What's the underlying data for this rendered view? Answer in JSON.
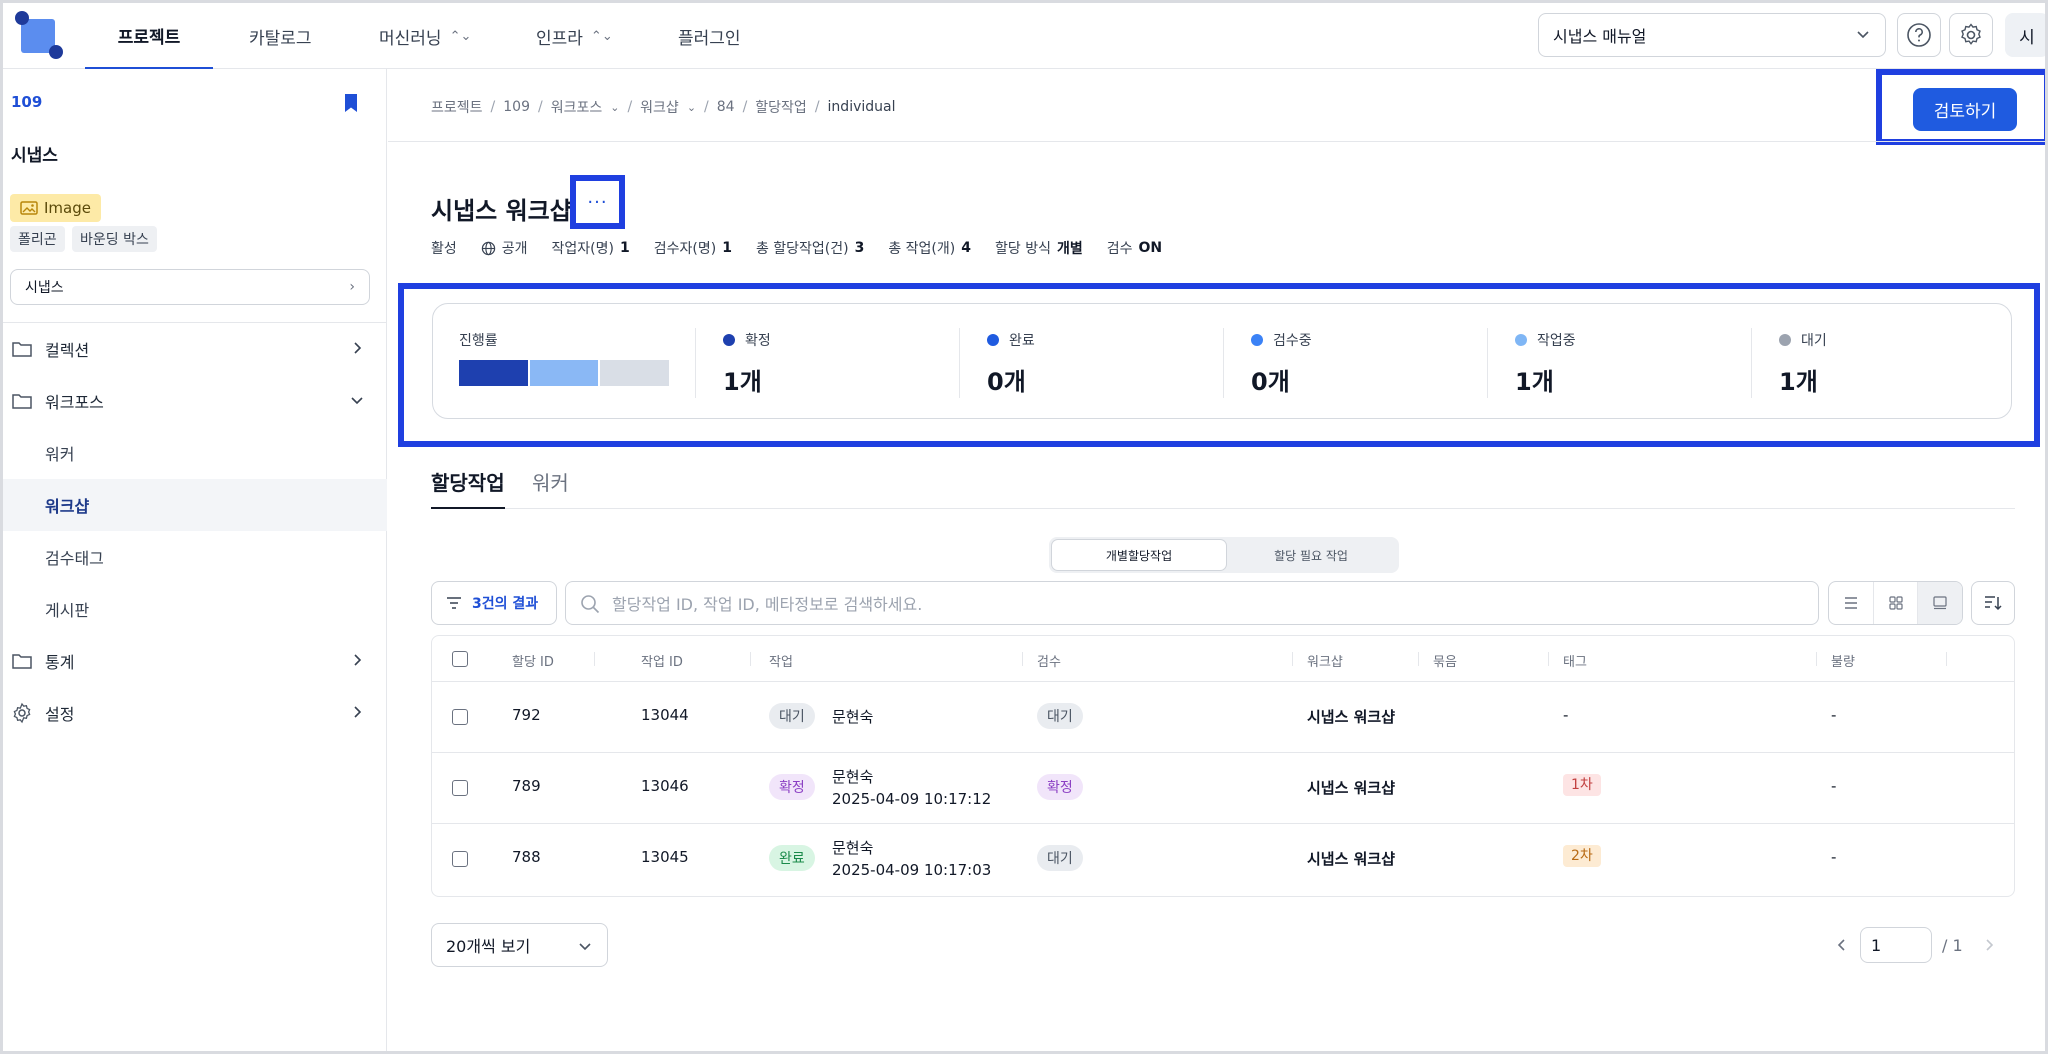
{
  "nav": {
    "tabs": [
      {
        "label": "프로젝트",
        "active": true
      },
      {
        "label": "카탈로그"
      },
      {
        "label": "머신러닝",
        "dropdown": true
      },
      {
        "label": "인프라",
        "dropdown": true
      },
      {
        "label": "플러그인"
      }
    ],
    "manual_select": "시냅스 매뉴얼",
    "avatar": "시",
    "icons": [
      "help-icon",
      "gear-icon"
    ]
  },
  "sidebar": {
    "project_id": "109",
    "project_name": "시냅스",
    "type_chip": "Image",
    "tool_chips": [
      "폴리곤",
      "바운딩 박스"
    ],
    "project_select": "시냅스",
    "menu": {
      "collection": "컬렉션",
      "workforce": "워크포스",
      "sub": [
        "워커",
        "워크샵",
        "검수태그",
        "게시판"
      ],
      "stats": "통계",
      "settings": "설정"
    }
  },
  "breadcrumb": [
    "프로젝트",
    "109",
    "워크포스",
    "워크샵",
    "84",
    "할당작업",
    "individual"
  ],
  "review_button": "검토하기",
  "workshop": {
    "title": "시냅스 워크샵",
    "more": "···",
    "meta": {
      "status": "활성",
      "visibility": "공개",
      "workers_label": "작업자(명)",
      "workers": "1",
      "reviewers_label": "검수자(명)",
      "reviewers": "1",
      "assignments_label": "총 할당작업(건)",
      "assignments": "3",
      "tasks_label": "총 작업(개)",
      "tasks": "4",
      "method_label": "할당 방식",
      "method": "개별",
      "review_label": "검수",
      "review": "ON"
    }
  },
  "progress": {
    "label": "진행률",
    "segments": [
      {
        "fraction": 0.333,
        "color": "#1e40af"
      },
      {
        "fraction": 0.333,
        "color": "#8ab8f5"
      },
      {
        "fraction": 0.334,
        "color": "#d9dee6"
      }
    ],
    "stats": [
      {
        "label": "확정",
        "value": "1개",
        "color": "#1e40af"
      },
      {
        "label": "완료",
        "value": "0개",
        "color": "#1f5be0"
      },
      {
        "label": "검수중",
        "value": "0개",
        "color": "#3b82f6"
      },
      {
        "label": "작업중",
        "value": "1개",
        "color": "#7fb6f5"
      },
      {
        "label": "대기",
        "value": "1개",
        "color": "#9ca3af"
      }
    ]
  },
  "tabs": [
    "할당작업",
    "워커"
  ],
  "segment": [
    "개별할당작업",
    "할당 필요 작업"
  ],
  "filter": {
    "result_prefix": "3건의 결과",
    "search_placeholder": "할당작업 ID, 작업 ID, 메타정보로 검색하세요."
  },
  "table": {
    "headers": [
      "할당 ID",
      "작업 ID",
      "작업",
      "검수",
      "워크샵",
      "묶음",
      "태그",
      "불량"
    ],
    "rows": [
      {
        "assign_id": "792",
        "task_id": "13044",
        "work_status": "대기",
        "worker": "문현숙",
        "time": "",
        "review": "대기",
        "workshop": "시냅스 워크샵",
        "tag": "-",
        "defect": "-"
      },
      {
        "assign_id": "789",
        "task_id": "13046",
        "work_status": "확정",
        "worker": "문현숙",
        "time": "2025-04-09 10:17:12",
        "review": "확정",
        "workshop": "시냅스 워크샵",
        "tag": "1차",
        "defect": "-"
      },
      {
        "assign_id": "788",
        "task_id": "13045",
        "work_status": "완료",
        "worker": "문현숙",
        "time": "2025-04-09 10:17:03",
        "review": "대기",
        "workshop": "시냅스 워크샵",
        "tag": "2차",
        "defect": "-"
      }
    ]
  },
  "pagination": {
    "page_size": "20개씩 보기",
    "page": "1",
    "total": "/ 1"
  }
}
